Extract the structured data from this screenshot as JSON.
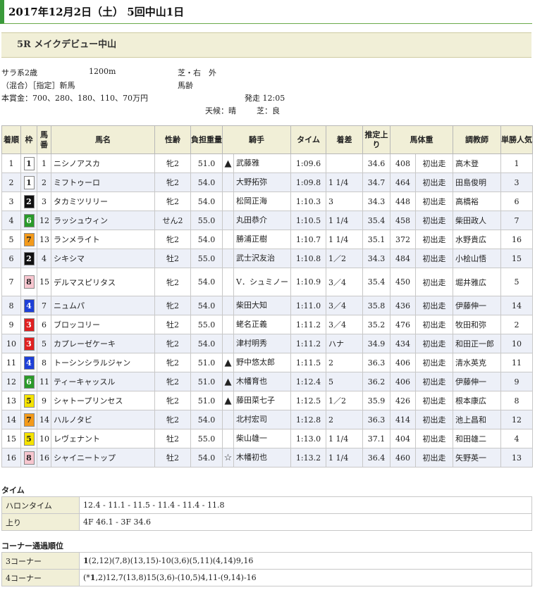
{
  "header": {
    "title": "2017年12月2日（土） 5回中山1日"
  },
  "race": {
    "name": "5R メイクデビュー中山",
    "class": "サラ系2歳",
    "distance": "1200m",
    "course": "芝・右　外",
    "cond": "（混合）［指定］新馬",
    "weight_rule": "馬齢",
    "prize": "本賞金：700、280、180、110、70万円",
    "start": "発走 12:05",
    "weather": "天候：晴",
    "going": "芝：良"
  },
  "headers": {
    "rank": "着順",
    "waku": "枠",
    "num": "馬番",
    "horse": "馬名",
    "sex": "性齢",
    "weight": "負担重量",
    "jockey": "騎手",
    "time": "タイム",
    "margin": "着差",
    "last3f": "推定上り",
    "body": "馬体重",
    "trainer": "調教師",
    "pop": "単勝人気"
  },
  "colors": {
    "accent": "#3a9a3a",
    "header_bg": "#f1efd7",
    "stripe": "#edf0f8"
  },
  "rows": [
    {
      "rank": "1",
      "waku": "1",
      "num": "1",
      "horse": "ニシノアスカ",
      "sex": "牝2",
      "weight": "51.0",
      "mark": "▲",
      "jockey": "武藤雅",
      "time": "1:09.6",
      "margin": "",
      "last3f": "34.6",
      "body": "408",
      "diff": "初出走",
      "trainer": "高木登",
      "pop": "1"
    },
    {
      "rank": "2",
      "waku": "1",
      "num": "2",
      "horse": "ミフトゥーロ",
      "sex": "牝2",
      "weight": "54.0",
      "mark": "",
      "jockey": "大野拓弥",
      "time": "1:09.8",
      "margin": "1 1/4",
      "last3f": "34.7",
      "body": "464",
      "diff": "初出走",
      "trainer": "田島俊明",
      "pop": "3"
    },
    {
      "rank": "3",
      "waku": "2",
      "num": "3",
      "horse": "タカミツリリー",
      "sex": "牝2",
      "weight": "54.0",
      "mark": "",
      "jockey": "松岡正海",
      "time": "1:10.3",
      "margin": "3",
      "last3f": "34.3",
      "body": "448",
      "diff": "初出走",
      "trainer": "高橋裕",
      "pop": "6"
    },
    {
      "rank": "4",
      "waku": "6",
      "num": "12",
      "horse": "ラッシュウィン",
      "sex": "せん2",
      "weight": "55.0",
      "mark": "",
      "jockey": "丸田恭介",
      "time": "1:10.5",
      "margin": "1 1/4",
      "last3f": "35.4",
      "body": "458",
      "diff": "初出走",
      "trainer": "柴田政人",
      "pop": "7"
    },
    {
      "rank": "5",
      "waku": "7",
      "num": "13",
      "horse": "ランメライト",
      "sex": "牝2",
      "weight": "54.0",
      "mark": "",
      "jockey": "勝浦正樹",
      "time": "1:10.7",
      "margin": "1 1/4",
      "last3f": "35.1",
      "body": "372",
      "diff": "初出走",
      "trainer": "水野貴広",
      "pop": "16"
    },
    {
      "rank": "6",
      "waku": "2",
      "num": "4",
      "horse": "シキシマ",
      "sex": "牡2",
      "weight": "55.0",
      "mark": "",
      "jockey": "武士沢友治",
      "time": "1:10.8",
      "margin": "1／2",
      "last3f": "34.3",
      "body": "484",
      "diff": "初出走",
      "trainer": "小桧山悟",
      "pop": "15"
    },
    {
      "rank": "7",
      "waku": "8",
      "num": "15",
      "horse": "デルマスピリタス",
      "sex": "牝2",
      "weight": "54.0",
      "mark": "",
      "jockey": "V．シュミノー",
      "time": "1:10.9",
      "margin": "3／4",
      "last3f": "35.4",
      "body": "450",
      "diff": "初出走",
      "trainer": "堀井雅広",
      "pop": "5"
    },
    {
      "rank": "8",
      "waku": "4",
      "num": "7",
      "horse": "ニュムパ",
      "sex": "牝2",
      "weight": "54.0",
      "mark": "",
      "jockey": "柴田大知",
      "time": "1:11.0",
      "margin": "3／4",
      "last3f": "35.8",
      "body": "436",
      "diff": "初出走",
      "trainer": "伊藤伸一",
      "pop": "14"
    },
    {
      "rank": "9",
      "waku": "3",
      "num": "6",
      "horse": "ブロッコリー",
      "sex": "牡2",
      "weight": "55.0",
      "mark": "",
      "jockey": "蛯名正義",
      "time": "1:11.2",
      "margin": "3／4",
      "last3f": "35.2",
      "body": "476",
      "diff": "初出走",
      "trainer": "牧田和弥",
      "pop": "2"
    },
    {
      "rank": "10",
      "waku": "3",
      "num": "5",
      "horse": "カプレーゼケーキ",
      "sex": "牝2",
      "weight": "54.0",
      "mark": "",
      "jockey": "津村明秀",
      "time": "1:11.2",
      "margin": "ハナ",
      "last3f": "34.9",
      "body": "434",
      "diff": "初出走",
      "trainer": "和田正一郎",
      "pop": "10"
    },
    {
      "rank": "11",
      "waku": "4",
      "num": "8",
      "horse": "トーシンシラルジャン",
      "sex": "牝2",
      "weight": "51.0",
      "mark": "▲",
      "jockey": "野中悠太郎",
      "time": "1:11.5",
      "margin": "2",
      "last3f": "36.3",
      "body": "406",
      "diff": "初出走",
      "trainer": "清水英克",
      "pop": "11"
    },
    {
      "rank": "12",
      "waku": "6",
      "num": "11",
      "horse": "ティーキャッスル",
      "sex": "牝2",
      "weight": "51.0",
      "mark": "▲",
      "jockey": "木幡育也",
      "time": "1:12.4",
      "margin": "5",
      "last3f": "36.2",
      "body": "406",
      "diff": "初出走",
      "trainer": "伊藤伸一",
      "pop": "9"
    },
    {
      "rank": "13",
      "waku": "5",
      "num": "9",
      "horse": "シャトープリンセス",
      "sex": "牝2",
      "weight": "51.0",
      "mark": "▲",
      "jockey": "藤田菜七子",
      "time": "1:12.5",
      "margin": "1／2",
      "last3f": "35.9",
      "body": "426",
      "diff": "初出走",
      "trainer": "根本康広",
      "pop": "8"
    },
    {
      "rank": "14",
      "waku": "7",
      "num": "14",
      "horse": "ハルノタビ",
      "sex": "牝2",
      "weight": "54.0",
      "mark": "",
      "jockey": "北村宏司",
      "time": "1:12.8",
      "margin": "2",
      "last3f": "36.3",
      "body": "414",
      "diff": "初出走",
      "trainer": "池上昌和",
      "pop": "12"
    },
    {
      "rank": "15",
      "waku": "5",
      "num": "10",
      "horse": "レヴェナント",
      "sex": "牡2",
      "weight": "55.0",
      "mark": "",
      "jockey": "柴山雄一",
      "time": "1:13.0",
      "margin": "1 1/4",
      "last3f": "37.1",
      "body": "404",
      "diff": "初出走",
      "trainer": "和田雄二",
      "pop": "4"
    },
    {
      "rank": "16",
      "waku": "8",
      "num": "16",
      "horse": "シャイニートップ",
      "sex": "牡2",
      "weight": "54.0",
      "mark": "☆",
      "jockey": "木幡初也",
      "time": "1:13.2",
      "margin": "1 1/4",
      "last3f": "36.4",
      "body": "460",
      "diff": "初出走",
      "trainer": "矢野英一",
      "pop": "13"
    }
  ],
  "time_section": {
    "title": "タイム",
    "rows": [
      {
        "label": "ハロンタイム",
        "value": "12.4 - 11.1 - 11.5 - 11.4 - 11.4 - 11.8"
      },
      {
        "label": "上り",
        "value": "4F 46.1 - 3F 34.6"
      }
    ]
  },
  "corner_section": {
    "title": "コーナー通過順位",
    "rows": [
      {
        "label": "3コーナー",
        "lead": "1",
        "value": "(2,12)(7,8)(13,15)-10(3,6)(5,11)(4,14)9,16"
      },
      {
        "label": "4コーナー",
        "pre": "(*",
        "lead": "1",
        "value": ",2)12,7(13,8)15(3,6)-(10,5)4,11-(9,14)-16"
      }
    ]
  }
}
